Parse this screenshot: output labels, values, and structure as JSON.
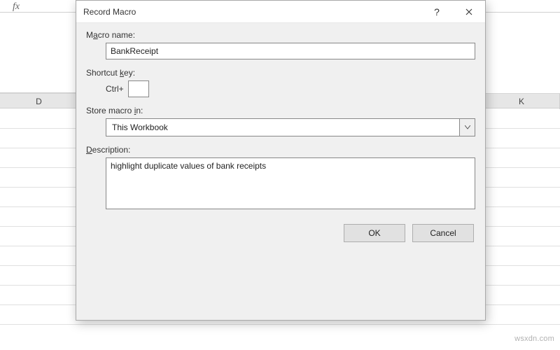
{
  "sheet": {
    "fx_label": "fx",
    "columns": {
      "d": "D",
      "k": "K"
    }
  },
  "dialog": {
    "title": "Record Macro",
    "help_tooltip": "?",
    "labels": {
      "macro_name_pre": "M",
      "macro_name_u": "a",
      "macro_name_post": "cro name:",
      "shortcut_pre": "Shortcut ",
      "shortcut_u": "k",
      "shortcut_post": "ey:",
      "ctrl": "Ctrl+",
      "store_pre": "Store macro ",
      "store_u": "i",
      "store_post": "n:",
      "desc_pre": "",
      "desc_u": "D",
      "desc_post": "escription:"
    },
    "fields": {
      "macro_name": "BankReceipt",
      "shortcut_key": "",
      "store_in_selected": "This Workbook",
      "description": "highlight duplicate values of bank receipts"
    },
    "buttons": {
      "ok": "OK",
      "cancel": "Cancel"
    }
  },
  "watermark": "wsxdn.com"
}
